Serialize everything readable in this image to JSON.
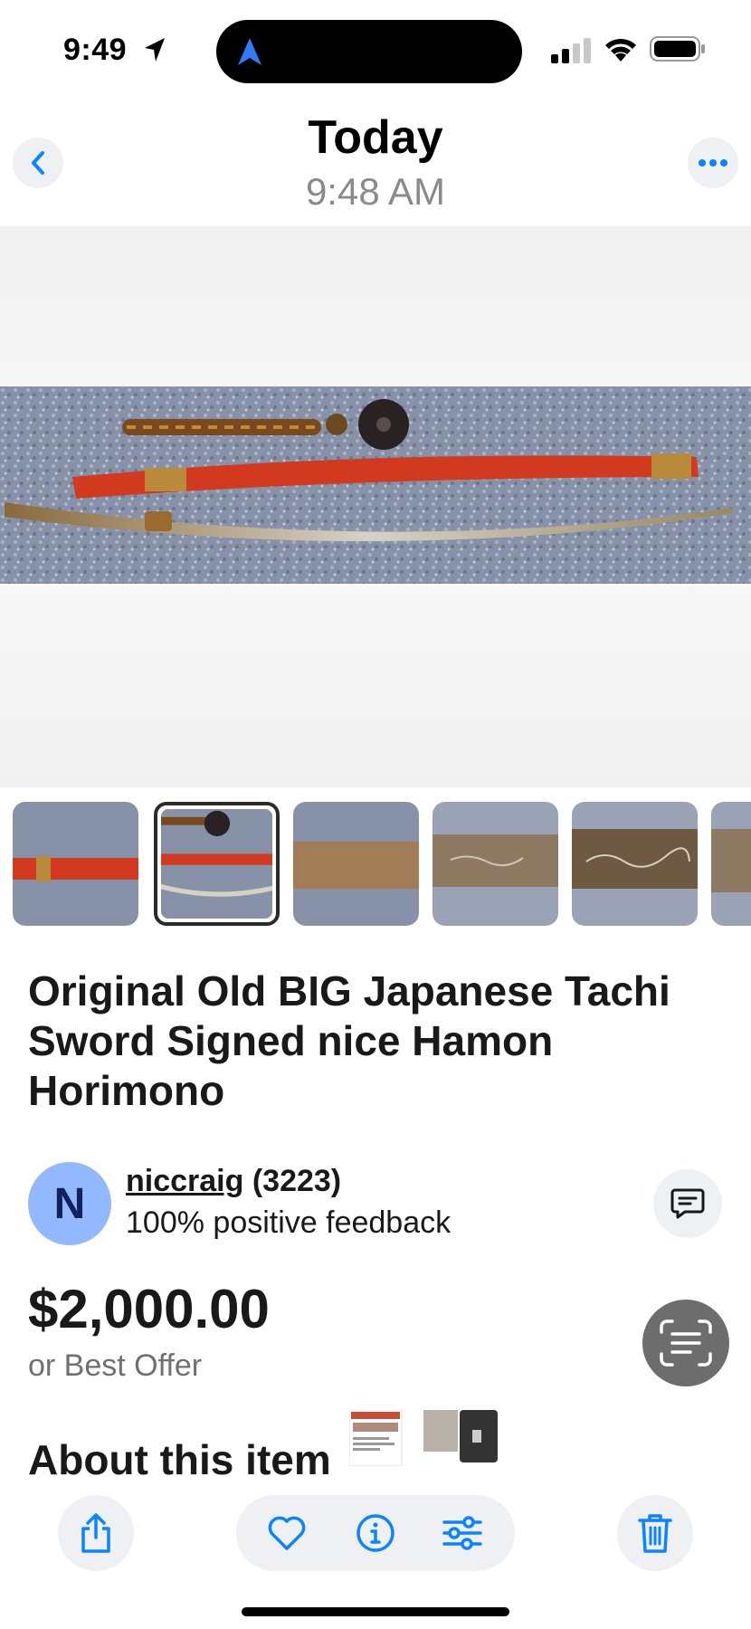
{
  "status_bar": {
    "time": "9:49",
    "icons": [
      "location-arrow-icon",
      "signal-icon",
      "wifi-icon",
      "battery-icon"
    ]
  },
  "header": {
    "title": "Today",
    "subtitle": "9:48 AM",
    "back_icon": "chevron-left-icon",
    "more_icon": "ellipsis-icon"
  },
  "gallery": {
    "thumbnails": [
      {
        "subject": "red scabbard close-up"
      },
      {
        "subject": "sword, scabbard and tsuba",
        "selected": true
      },
      {
        "subject": "blade detail"
      },
      {
        "subject": "engraved blade"
      },
      {
        "subject": "engraved blade horimono"
      },
      {
        "subject": "blade"
      }
    ]
  },
  "item": {
    "title": "Original Old BIG Japanese Tachi Sword Signed nice Hamon Horimono"
  },
  "seller": {
    "avatar_letter": "N",
    "name": "niccraig",
    "score": "(3223)",
    "feedback": "100% positive feedback"
  },
  "pricing": {
    "price": "$2,000.00",
    "sub": "or Best Offer"
  },
  "about": {
    "title": "About this item"
  },
  "toolbar": {
    "icons": [
      "share-icon",
      "heart-icon",
      "info-icon",
      "adjust-sliders-icon",
      "trash-icon"
    ]
  },
  "colors": {
    "accent_blue": "#0a84ff",
    "avatar_bg": "#92b9ff",
    "scabbard_red": "#d23a1f"
  }
}
